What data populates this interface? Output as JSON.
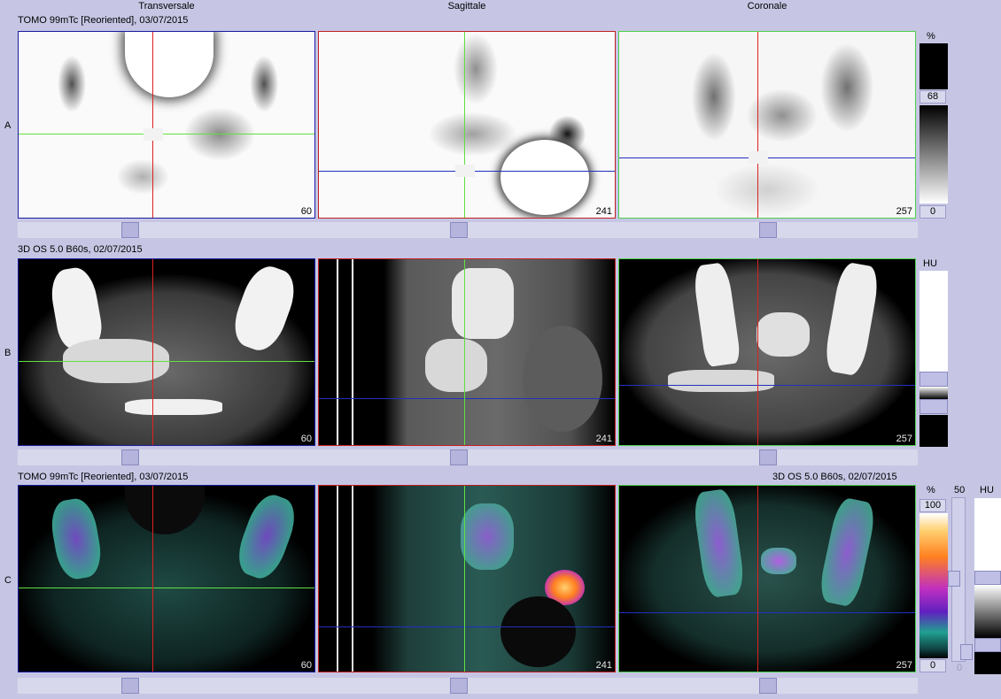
{
  "columns": {
    "transversal": "Transversale",
    "sagittal": "Sagittale",
    "coronal": "Coronale"
  },
  "rows": {
    "a": "A",
    "b": "B",
    "c": "C"
  },
  "series": {
    "pet": "TOMO 99mTc [Reoriented], 03/07/2015",
    "ct": "3D  OS  5.0  B60s, 02/07/2015",
    "fusion_left": "TOMO 99mTc [Reoriented], 03/07/2015",
    "fusion_right": "3D  OS  5.0  B60s, 02/07/2015"
  },
  "slices": {
    "transversal": "60",
    "sagittal": "241",
    "coronal": "257"
  },
  "colorbars": {
    "pet": {
      "unit": "%",
      "max": "68",
      "min": "0"
    },
    "ct": {
      "unit": "HU"
    },
    "fusion_pet": {
      "unit": "%",
      "max": "100",
      "min": "0"
    },
    "fusion_mix": {
      "top": "50",
      "bottom": "0"
    },
    "fusion_ct": {
      "unit": "HU"
    }
  },
  "colors": {
    "background": "#c6c6e4",
    "transversal_border": "#1a1aa0",
    "sagittal_border": "#c02020",
    "coronal_border": "#4cd04c",
    "crosshair_red": "#e02020",
    "crosshair_green": "#60e040",
    "crosshair_blue": "#2030c0"
  }
}
